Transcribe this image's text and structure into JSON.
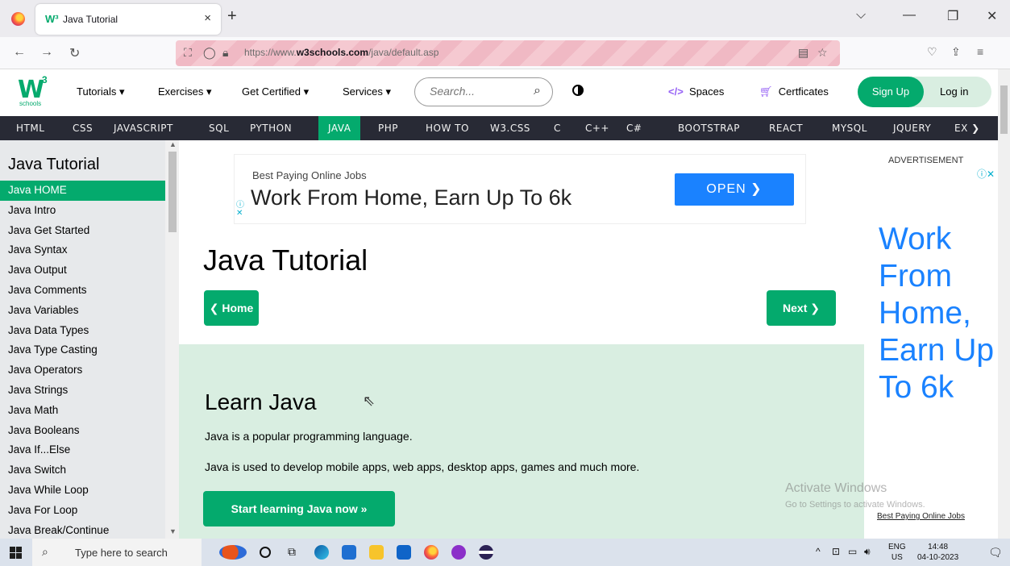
{
  "browser": {
    "tab_title": "Java Tutorial",
    "tab_close": "×",
    "new_tab": "+",
    "url_prefix": "https://www.",
    "url_domain": "w3schools.com",
    "url_path": "/java/default.asp",
    "window_controls": {
      "dropdown": "⌵",
      "minimize": "—",
      "maximize": "❐",
      "close": "✕"
    }
  },
  "w3": {
    "logo_main": "W",
    "logo_sup": "3",
    "logo_sub": "schools",
    "menu": [
      "Tutorials ▾",
      "Exercises ▾",
      "Get Certified ▾",
      "Services ▾"
    ],
    "search_placeholder": "Search...",
    "spaces_code": "</>",
    "spaces_label": "Spaces",
    "certs_label": "Certficates",
    "signup": "Sign Up",
    "login": "Log in"
  },
  "darknav": {
    "items": [
      "HTML",
      "CSS",
      "JAVASCRIPT",
      "SQL",
      "PYTHON",
      "JAVA",
      "PHP",
      "HOW TO",
      "W3.CSS",
      "C",
      "C++",
      "C#",
      "BOOTSTRAP",
      "REACT",
      "MYSQL",
      "JQUERY",
      "EX ❯"
    ],
    "active": "JAVA"
  },
  "sidebar": {
    "title": "Java Tutorial",
    "items": [
      "Java HOME",
      "Java Intro",
      "Java Get Started",
      "Java Syntax",
      "Java Output",
      "Java Comments",
      "Java Variables",
      "Java Data Types",
      "Java Type Casting",
      "Java Operators",
      "Java Strings",
      "Java Math",
      "Java Booleans",
      "Java If...Else",
      "Java Switch",
      "Java While Loop",
      "Java For Loop",
      "Java Break/Continue"
    ],
    "active_index": 0
  },
  "ad_banner": {
    "small": "Best Paying Online Jobs",
    "big": "Work From Home, Earn Up To 6k",
    "button": "OPEN ❯"
  },
  "main": {
    "title": "Java Tutorial",
    "home_button": "❮ Home",
    "next_button": "Next ❯",
    "learn_title": "Learn Java",
    "p1": "Java is a popular programming language.",
    "p2": "Java is used to develop mobile apps, web apps, desktop apps, games and much more.",
    "start_button": "Start learning Java now »"
  },
  "right_ad": {
    "label": "ADVERTISEMENT",
    "big": "Work From Home, Earn Up To 6k",
    "bottom": "Best Paying Online Jobs"
  },
  "watermark": {
    "line1": "Activate Windows",
    "line2": "Go to Settings to activate Windows."
  },
  "taskbar": {
    "search_placeholder": "Type here to search",
    "lang_top": "ENG",
    "lang_bottom": "US",
    "time": "14:48",
    "date": "04-10-2023"
  },
  "colors": {
    "brand": "#04aa6d",
    "dark_nav": "#282a35",
    "ad_blue": "#1a82ff",
    "sidebar_bg": "#e7e9eb",
    "learn_bg": "#d9eee1"
  }
}
